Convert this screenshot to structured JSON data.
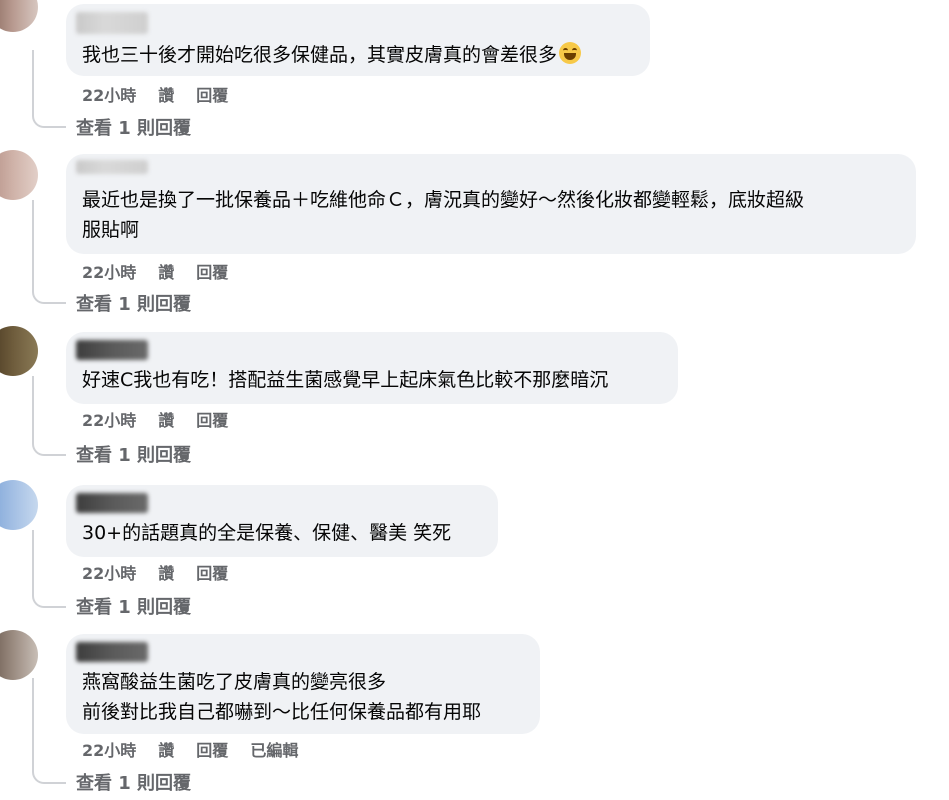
{
  "comments": [
    {
      "lines": [
        "我也三十後才開始吃很多保健品，其實皮膚真的會差很多"
      ],
      "has_emoji": true,
      "emoji_icon": "laughing-tears-emoji-icon",
      "time": "22小時",
      "like": "讚",
      "reply": "回覆",
      "view_replies": "查看 1 則回覆",
      "avatar_colors": [
        "#8a6a5e",
        "#d7c7c0"
      ]
    },
    {
      "lines": [
        "最近也是換了一批保養品＋吃維他命Ｃ，膚況真的變好～然後化妝都變輕鬆，底妝超級",
        "服貼啊"
      ],
      "time": "22小時",
      "like": "讚",
      "reply": "回覆",
      "view_replies": "查看 1 則回覆",
      "avatar_colors": [
        "#b69187",
        "#e2cfc8"
      ]
    },
    {
      "lines": [
        "好速C我也有吃！搭配益生菌感覺早上起床氣色比較不那麼暗沉"
      ],
      "time": "22小時",
      "like": "讚",
      "reply": "回覆",
      "view_replies": "查看 1 則回覆",
      "avatar_colors": [
        "#4b3a22",
        "#8a7a56"
      ]
    },
    {
      "lines": [
        "30+的話題真的全是保養、保健、醫美 笑死"
      ],
      "time": "22小時",
      "like": "讚",
      "reply": "回覆",
      "view_replies": "查看 1 則回覆",
      "avatar_colors": [
        "#7fa6d8",
        "#c6d8ee"
      ]
    },
    {
      "lines": [
        "燕窩酸益生菌吃了皮膚真的變亮很多",
        "前後對比我自己都嚇到～比任何保養品都有用耶"
      ],
      "time": "22小時",
      "like": "讚",
      "reply": "回覆",
      "edited": "已編輯",
      "view_replies": "查看 1 則回覆",
      "avatar_colors": [
        "#6a5a4e",
        "#c8beb6"
      ]
    }
  ]
}
